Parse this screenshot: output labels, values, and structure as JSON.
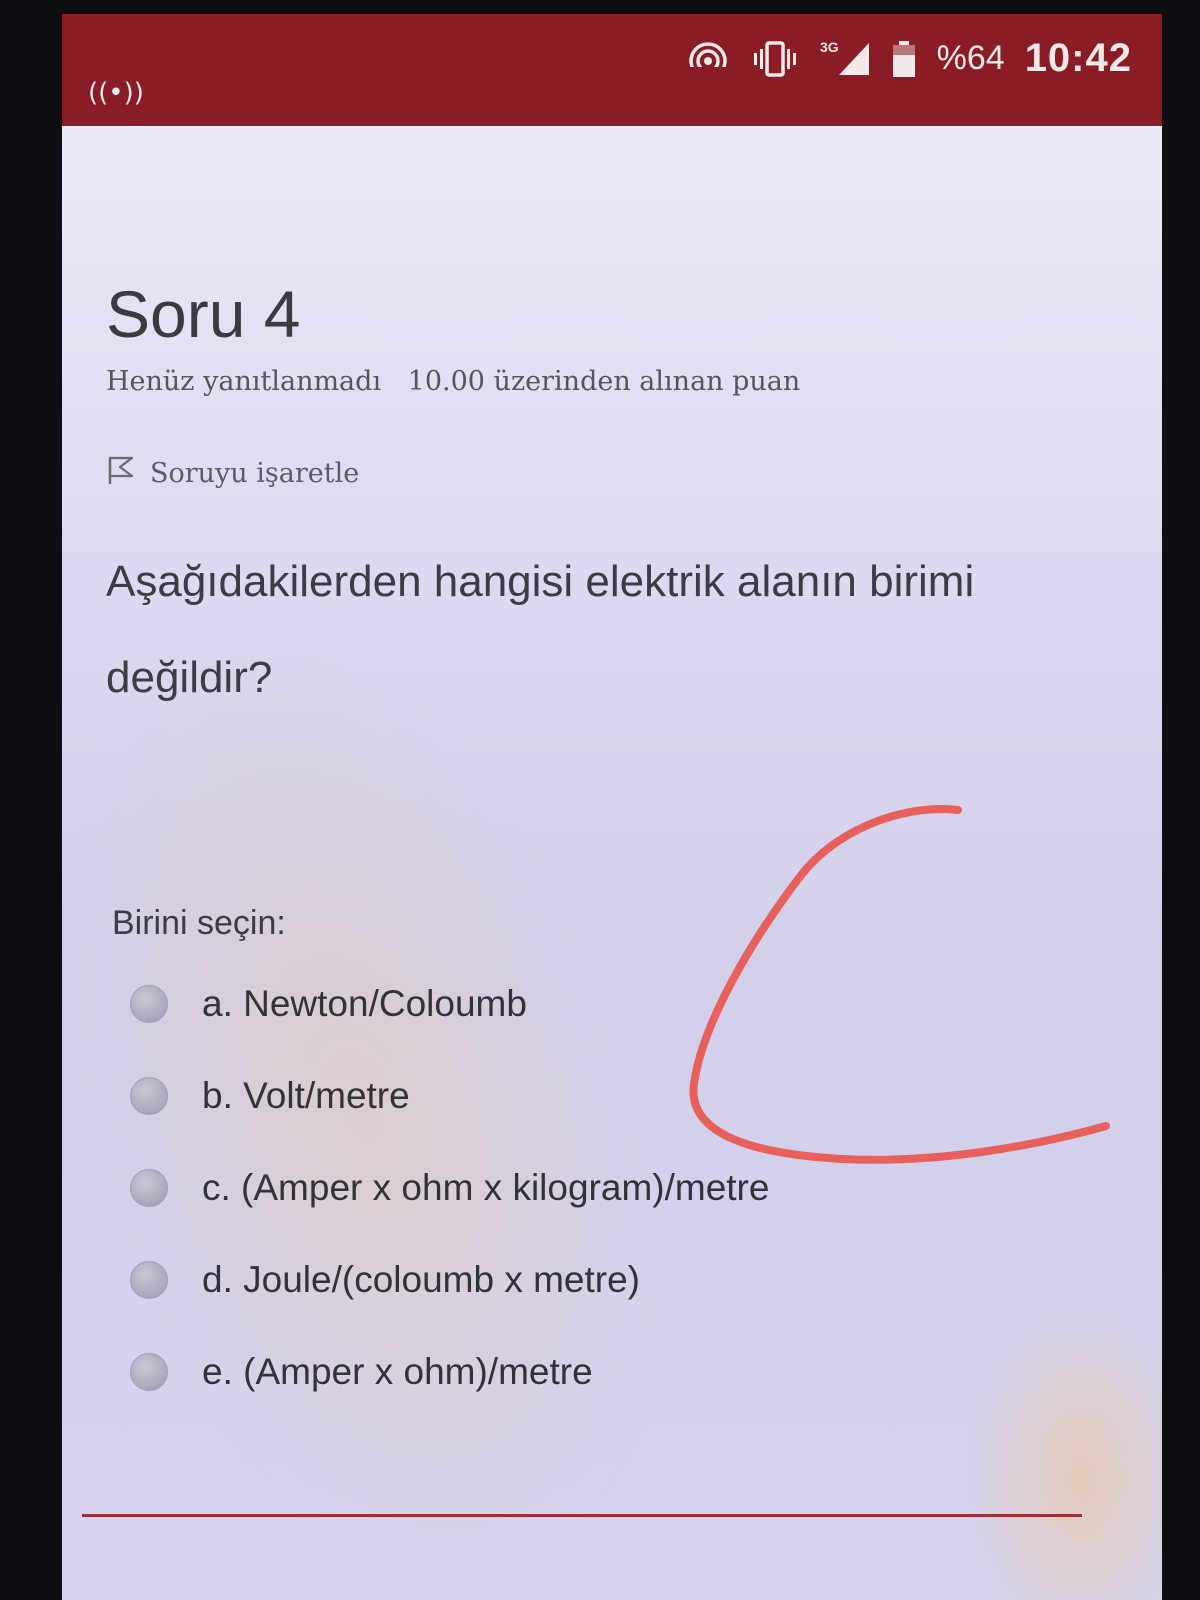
{
  "status_bar": {
    "network": "3G",
    "battery": "%64",
    "time": "10:42",
    "icons": [
      "hotspot-icon",
      "wifi-icon",
      "vibrate-icon",
      "signal-icon",
      "battery-icon"
    ]
  },
  "question": {
    "title": "Soru 4",
    "status": "Henüz yanıtlanmadı",
    "points": "10.00 üzerinden alınan puan",
    "flag_label": "Soruyu işaretle",
    "text": "Aşağıdakilerden hangisi elektrik alanın birimi değildir?"
  },
  "answers": {
    "prompt": "Birini seçin:",
    "options": [
      "a. Newton/Coloumb",
      "b. Volt/metre",
      "c. (Amper x ohm x kilogram)/metre",
      "d. Joule/(coloumb x metre)",
      "e. (Amper x ohm)/metre"
    ]
  },
  "colors": {
    "status_bar": "#8a1c26",
    "annotation": "#e8605c",
    "divider": "#9a2f3a"
  }
}
